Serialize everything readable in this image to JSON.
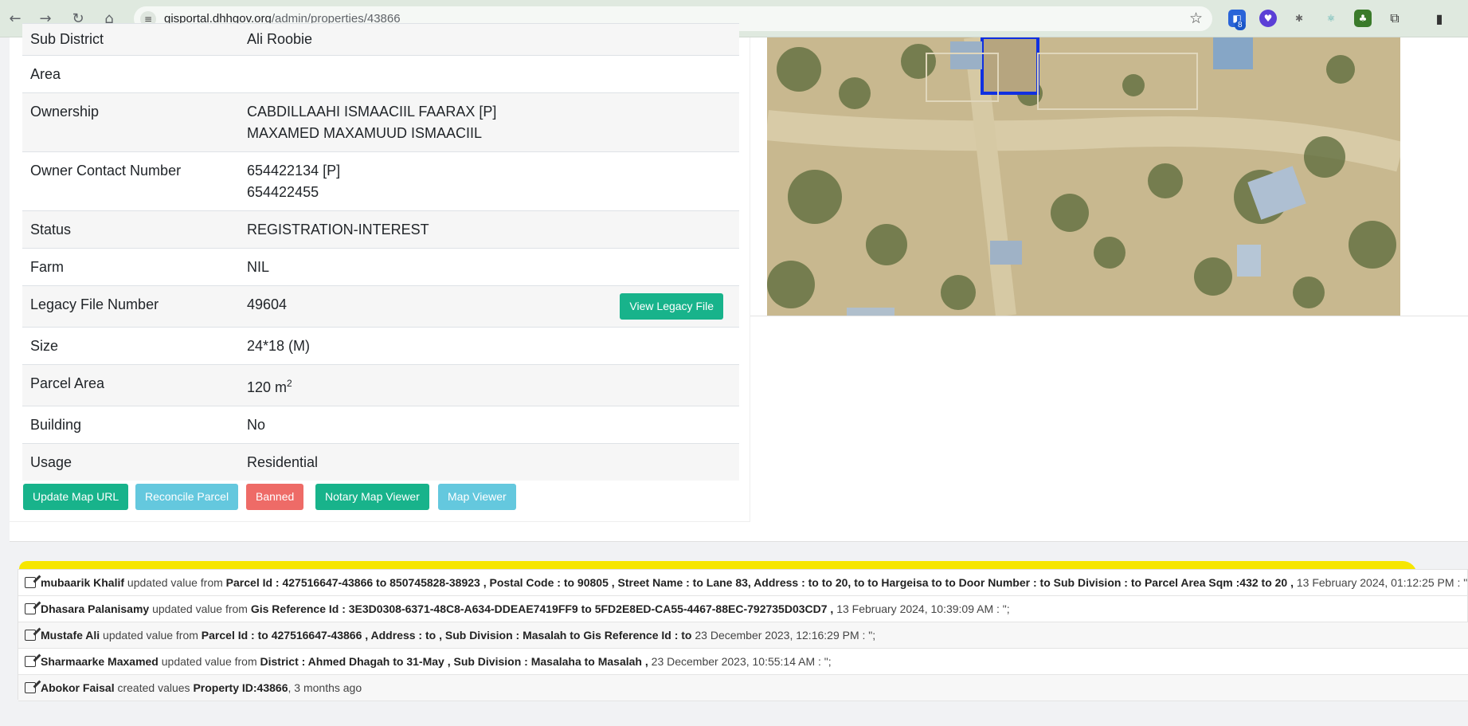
{
  "browser": {
    "url_host": "gisportal.dhhgov.org",
    "url_path": "/admin/properties/43866",
    "extension_badge": "8"
  },
  "details": [
    {
      "key": "Sub District",
      "value": "Ali Roobie"
    },
    {
      "key": "Area",
      "value": ""
    },
    {
      "key": "Ownership",
      "value_lines": [
        "CABDILLAAHI ISMAACIIL FAARAX [P]",
        "MAXAMED MAXAMUUD ISMAACIIL"
      ]
    },
    {
      "key": "Owner Contact Number",
      "value_lines": [
        "654422134 [P]",
        "654422455"
      ]
    },
    {
      "key": "Status",
      "value": "REGISTRATION-INTEREST"
    },
    {
      "key": "Farm",
      "value": "NIL"
    },
    {
      "key": "Legacy File Number",
      "value": "49604",
      "button": "View Legacy File"
    },
    {
      "key": "Size",
      "value": "24*18 (M)"
    },
    {
      "key": "Parcel Area",
      "value": "120 m",
      "sup": "2"
    },
    {
      "key": "Building",
      "value": "No"
    },
    {
      "key": "Usage",
      "value": "Residential"
    }
  ],
  "actions": {
    "update_map_url": "Update Map URL",
    "reconcile_parcel": "Reconcile Parcel",
    "banned": "Banned",
    "notary_map_viewer": "Notary Map Viewer",
    "map_viewer": "Map Viewer"
  },
  "log": [
    {
      "user": "mubaarik Khalif",
      "verb": "updated value from",
      "changes": "Parcel Id : 427516647-43866 to 850745828-38923 , Postal Code : to 90805 , Street Name : to Lane 83, Address : to to 20, to to Hargeisa to to Door Number : to Sub Division : to Parcel Area Sqm :432 to 20 ,",
      "time": "13 February 2024, 01:12:25 PM : \";"
    },
    {
      "user": "Dhasara Palanisamy",
      "verb": "updated value from",
      "changes": "Gis Reference Id : 3E3D0308-6371-48C8-A634-DDEAE7419FF9 to 5FD2E8ED-CA55-4467-88EC-792735D03CD7 ,",
      "time": "13 February 2024, 10:39:09 AM : \";"
    },
    {
      "user": "Mustafe Ali",
      "verb": "updated value from",
      "changes": "Parcel Id : to 427516647-43866 , Address : to , Sub Division : Masalah to Gis Reference Id : to",
      "time": "23 December 2023, 12:16:29 PM : \";"
    },
    {
      "user": "Sharmaarke Maxamed",
      "verb": "updated value from",
      "changes": "District : Ahmed Dhagah to 31-May , Sub Division : Masalaha to Masalah ,",
      "time": "23 December 2023, 10:55:14 AM : \";"
    },
    {
      "user": "Abokor Faisal",
      "verb": "created values",
      "changes": "Property ID:43866",
      "time": ", 3 months ago"
    }
  ]
}
